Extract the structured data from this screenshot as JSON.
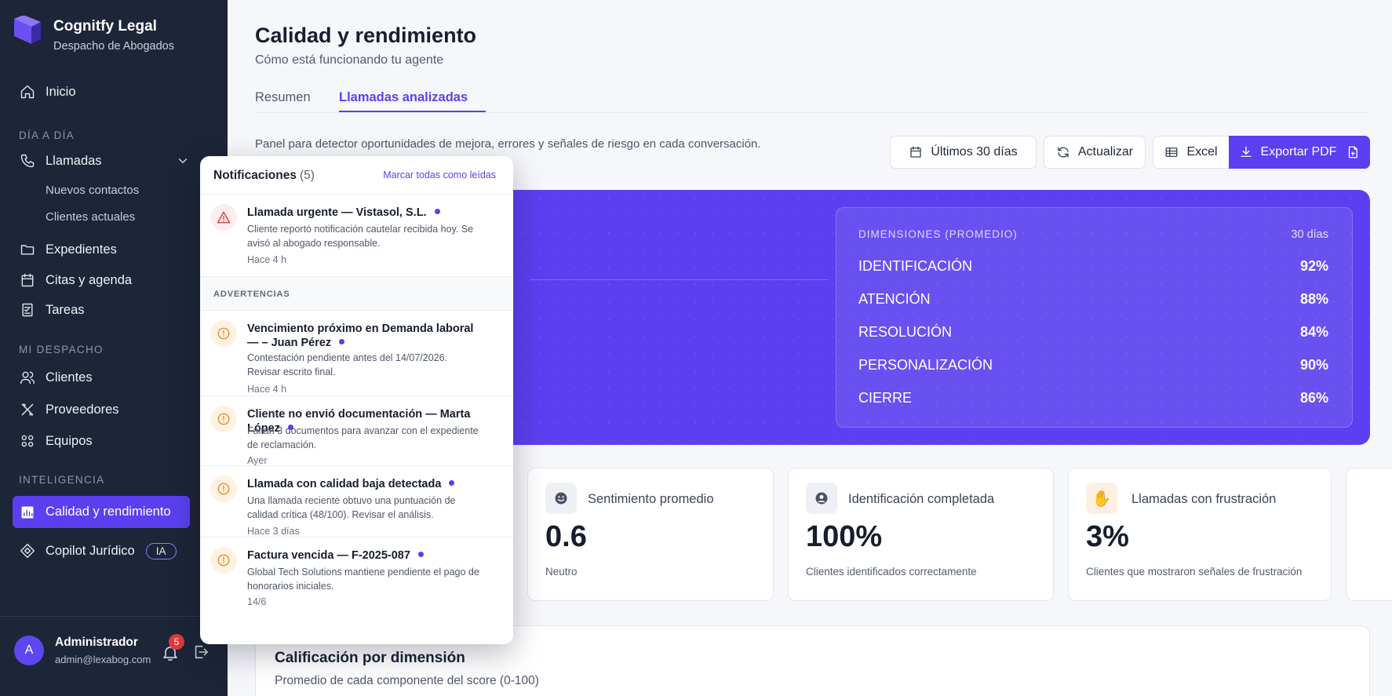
{
  "brand": {
    "name": "Cognitfy Legal",
    "subtitle": "Despacho de Abogados"
  },
  "sidebar": {
    "inicio": "Inicio",
    "section_dia": "DÍA A DÍA",
    "llamadas": "Llamadas",
    "nuevos": "Nuevos contactos",
    "clientes_actuales": "Clientes actuales",
    "expedientes": "Expedientes",
    "citas": "Citas y agenda",
    "tareas": "Tareas",
    "section_despacho": "MI DESPACHO",
    "clientes": "Clientes",
    "proveedores": "Proveedores",
    "equipos": "Equipos",
    "section_inteligencia": "INTELIGENCIA",
    "calidad": "Calidad y rendimiento",
    "copilot": "Copilot Jurídico",
    "ia_badge": "IA"
  },
  "user": {
    "initial": "A",
    "name": "Administrador",
    "email": "admin@lexabog.com",
    "notif_count": "5"
  },
  "header": {
    "title": "Calidad y rendimiento",
    "subtitle": "Cómo está funcionando tu agente",
    "tabs": [
      "Resumen",
      "Llamadas analizadas"
    ],
    "description": "Panel para detector oportunidades de mejora, errores y señales de riesgo en cada conversación."
  },
  "toolbar": {
    "period": "Últimos 30 días",
    "refresh": "Actualizar",
    "excel": "Excel",
    "export_pdf": "Exportar PDF"
  },
  "dimensions": {
    "heading": "DIMENSIONES (PROMEDIO)",
    "period": "30 días",
    "rows": [
      {
        "label": "IDENTIFICACIÓN",
        "value": "92%"
      },
      {
        "label": "ATENCIÓN",
        "value": "88%"
      },
      {
        "label": "RESOLUCIÓN",
        "value": "84%"
      },
      {
        "label": "PERSONALIZACIÓN",
        "value": "90%"
      },
      {
        "label": "CIERRE",
        "value": "86%"
      }
    ]
  },
  "cards": [
    {
      "title": "Sentimiento promedio",
      "value": "0.6",
      "foot": "Neutro",
      "icon": "smile-icon"
    },
    {
      "title": "Identificación completada",
      "value": "100%",
      "foot": "Clientes identificados correctamente",
      "icon": "user-icon"
    },
    {
      "title": "Llamadas con frustración",
      "value": "3%",
      "foot": "Clientes que mostraron señales de frustración",
      "icon": "hand-icon"
    }
  ],
  "score_card": {
    "title": "Calificación por dimensión",
    "subtitle": "Promedio de cada componente del score (0-100)"
  },
  "notifications": {
    "title": "Notificaciones",
    "count": "(5)",
    "mark_all": "Marcar todas como leídas",
    "section_warnings": "ADVERTENCIAS",
    "items": [
      {
        "title": "Llamada urgente — Vistasol, S.L.",
        "desc": "Cliente reportó notificación cautelar recibida hoy. Se avisó al abogado responsable.",
        "time": "Hace 4 h",
        "kind": "alert"
      },
      {
        "title": "Vencimiento próximo en Demanda laboral — – Juan Pérez",
        "desc": "Contestación pendiente antes del 14/07/2026. Revisar escrito final.",
        "time": "Hace 4 h",
        "kind": "warning"
      },
      {
        "title": "Cliente no envió documentación — Marta López",
        "desc": "Faltan 3 documentos para avanzar con el expediente de reclamación.",
        "time": "Ayer",
        "kind": "warning"
      },
      {
        "title": "Llamada con calidad baja detectada",
        "desc": "Una llamada reciente obtuvo una puntuación de calidad crítica (48/100). Revisar el análisis.",
        "time": "Hace 3 días",
        "kind": "warning"
      },
      {
        "title": "Factura vencida — F-2025-087",
        "desc": "Global Tech Solutions mantiene pendiente el pago de honorarios iniciales.",
        "time": "14/6",
        "kind": "warning"
      }
    ]
  },
  "colors": {
    "accent": "#5b3ff0",
    "sidebar": "#1d2538",
    "alert": "#d83a3a",
    "warning": "#ea8b1b"
  }
}
